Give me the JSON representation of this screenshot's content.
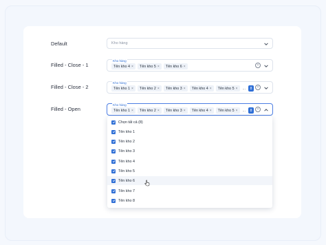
{
  "rows": {
    "default": {
      "label": "Default",
      "placeholder": "Kho hàng"
    },
    "close1": {
      "label": "Filled - Close - 1",
      "field_label": "Kho hàng",
      "tags": [
        "Tên kho 4",
        "Tên kho 5",
        "Tên kho 6"
      ]
    },
    "close2": {
      "label": "Filled - Close - 2",
      "field_label": "Kho hàng",
      "tags": [
        "Tên kho 1",
        "Tên kho 2",
        "Tên kho 3",
        "Tên kho 4",
        "Tên kho 5"
      ],
      "more": "...",
      "count": "8"
    },
    "open": {
      "label": "Filled - Open",
      "field_label": "Kho hàng",
      "tags": [
        "Tên kho 1",
        "Tên kho 2",
        "Tên kho 3",
        "Tên kho 4",
        "Tên kho 5"
      ],
      "more": "...",
      "count": "8"
    }
  },
  "dropdown": {
    "options": [
      "Chọn tất cả (8)",
      "Tên kho 1",
      "Tên kho 2",
      "Tên kho 3",
      "Tên kho 4",
      "Tên kho 5",
      "Tên kho 6",
      "Tên kho 7",
      "Tên kho 8"
    ],
    "hovered_option": "Tên kho 6",
    "all_checked": true
  },
  "icons": {
    "tag_remove": "×",
    "clear": "×"
  },
  "colors": {
    "accent": "#2f6fd6",
    "tag_bg": "#eef2f8",
    "focus_border": "#4b7de3"
  }
}
